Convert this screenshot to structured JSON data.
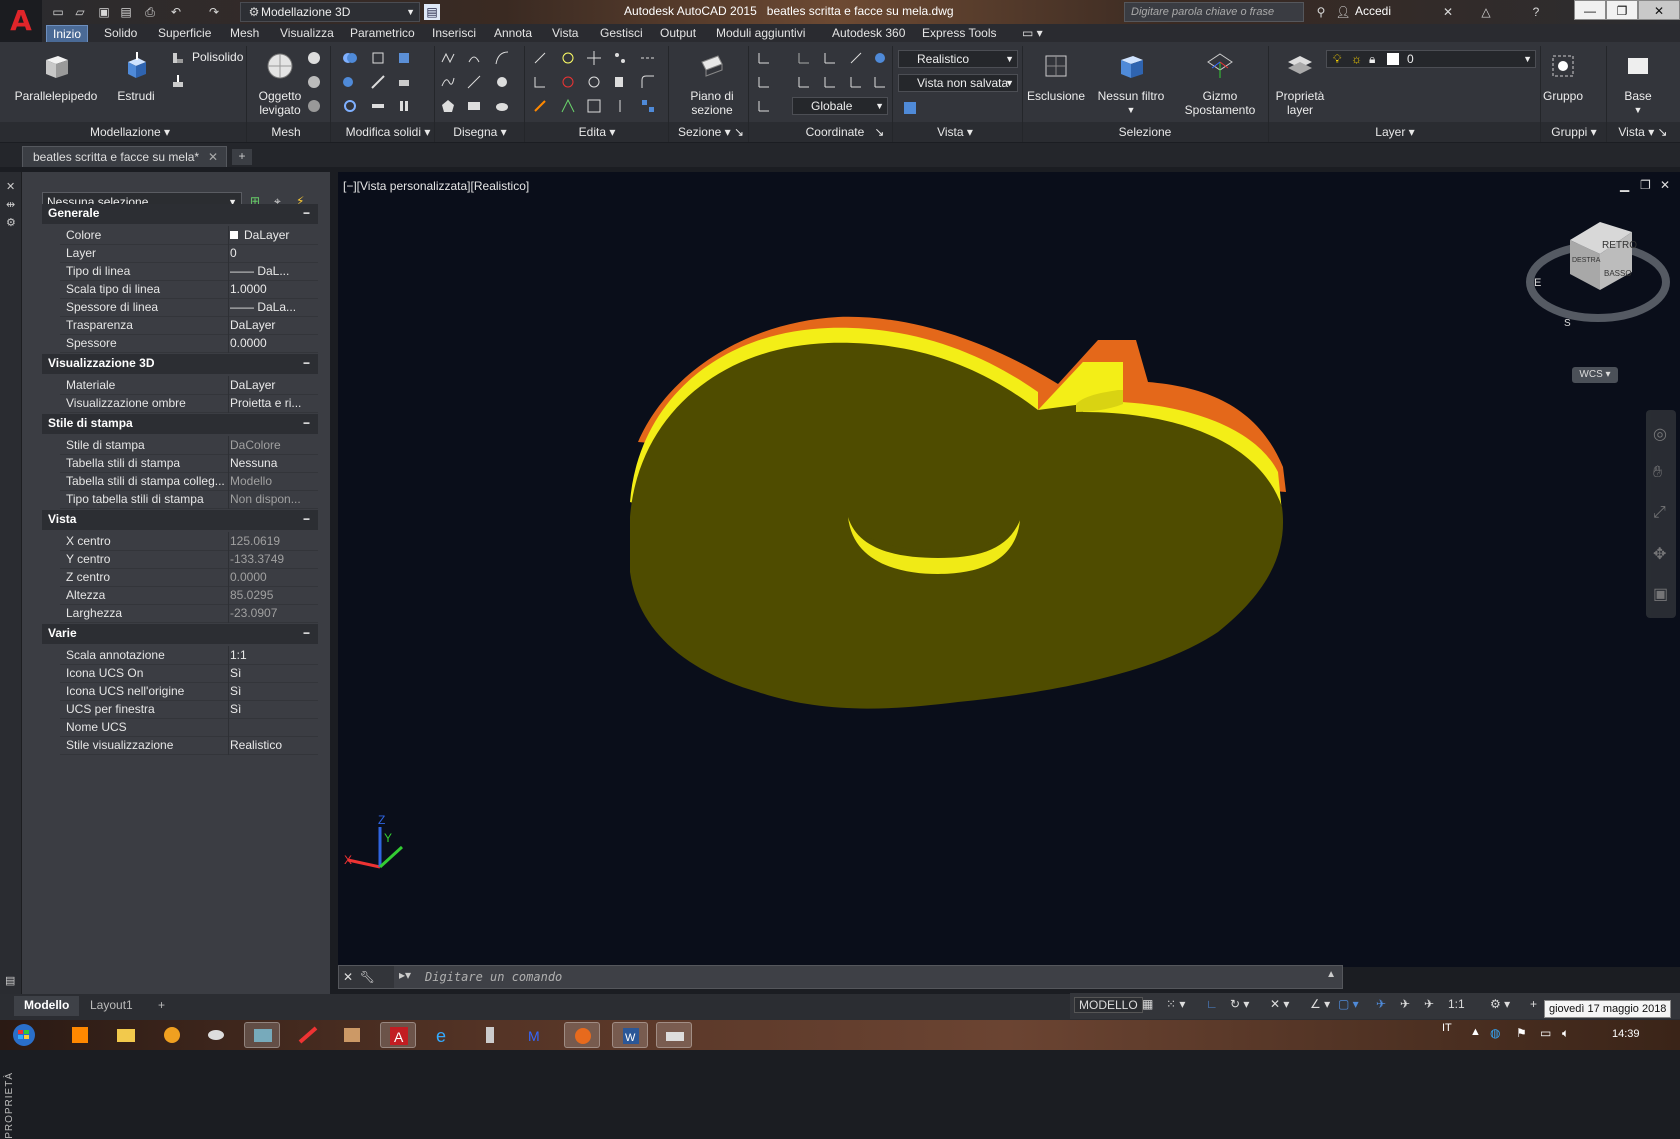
{
  "titlebar": {
    "workspace": "Modellazione 3D",
    "app_name": "Autodesk AutoCAD 2015",
    "file_name": "beatles scritta e facce su mela.dwg",
    "search_placeholder": "Digitare parola chiave o frase",
    "signin": "Accedi"
  },
  "ribbon_tabs": [
    "Inizio",
    "Solido",
    "Superficie",
    "Mesh",
    "Visualizza",
    "Parametrico",
    "Inserisci",
    "Annota",
    "Vista",
    "Gestisci",
    "Output",
    "Moduli aggiuntivi",
    "Autodesk 360",
    "Express Tools"
  ],
  "ribbon": {
    "parallelepipedo": "Parallelepipedo",
    "estrudi": "Estrudi",
    "polisolido": "Polisolido",
    "oggetto_levigato_1": "Oggetto",
    "oggetto_levigato_2": "levigato",
    "piano_sezione_1": "Piano di",
    "piano_sezione_2": "sezione",
    "visual_style": "Realistico",
    "named_view": "Vista non salvata",
    "ucs": "Globale",
    "esclusione": "Esclusione",
    "nessun_filtro": "Nessun filtro",
    "gizmo_1": "Gizmo",
    "gizmo_2": "Spostamento",
    "proprieta_1": "Proprietà",
    "proprieta_2": "layer",
    "layer_current": "0",
    "gruppo": "Gruppo",
    "base": "Base",
    "panels": {
      "modellazione": "Modellazione",
      "mesh": "Mesh",
      "modifica_solidi": "Modifica solidi",
      "disegna": "Disegna",
      "edita": "Edita",
      "sezione": "Sezione",
      "coordinate": "Coordinate",
      "vista": "Vista",
      "selezione": "Selezione",
      "layer": "Layer",
      "gruppi": "Gruppi",
      "vista2": "Vista"
    }
  },
  "doc_tab": "beatles scritta e facce su mela*",
  "properties": {
    "selection": "Nessuna selezione",
    "palette_title": "PROPRIETÀ",
    "sections": [
      {
        "title": "Generale",
        "rows": [
          {
            "k": "Colore",
            "v": "DaLayer"
          },
          {
            "k": "Layer",
            "v": "0"
          },
          {
            "k": "Tipo di linea",
            "v": "—— DaL..."
          },
          {
            "k": "Scala tipo di linea",
            "v": "1.0000"
          },
          {
            "k": "Spessore di linea",
            "v": "—— DaLa..."
          },
          {
            "k": "Trasparenza",
            "v": "DaLayer"
          },
          {
            "k": "Spessore",
            "v": "0.0000"
          }
        ]
      },
      {
        "title": "Visualizzazione 3D",
        "rows": [
          {
            "k": "Materiale",
            "v": "DaLayer"
          },
          {
            "k": "Visualizzazione ombre",
            "v": "Proietta e ri..."
          }
        ]
      },
      {
        "title": "Stile di stampa",
        "rows": [
          {
            "k": "Stile di stampa",
            "v": "DaColore"
          },
          {
            "k": "Tabella stili di stampa",
            "v": "Nessuna"
          },
          {
            "k": "Tabella stili di stampa colleg...",
            "v": "Modello"
          },
          {
            "k": "Tipo tabella stili di stampa",
            "v": "Non dispon..."
          }
        ]
      },
      {
        "title": "Vista",
        "rows": [
          {
            "k": "X centro",
            "v": "125.0619"
          },
          {
            "k": "Y centro",
            "v": "-133.3749"
          },
          {
            "k": "Z centro",
            "v": "0.0000"
          },
          {
            "k": "Altezza",
            "v": "85.0295"
          },
          {
            "k": "Larghezza",
            "v": "-23.0907"
          }
        ]
      },
      {
        "title": "Varie",
        "rows": [
          {
            "k": "Scala annotazione",
            "v": "1:1"
          },
          {
            "k": "Icona UCS On",
            "v": "Sì"
          },
          {
            "k": "Icona UCS nell'origine",
            "v": "Sì"
          },
          {
            "k": "UCS per finestra",
            "v": "Sì"
          },
          {
            "k": "Nome UCS",
            "v": ""
          },
          {
            "k": "Stile visualizzazione",
            "v": "Realistico"
          }
        ]
      }
    ]
  },
  "viewport": {
    "label": "[−][Vista personalizzata][Realistico]",
    "viewcube_top": "RETRO",
    "viewcube_front": "BASSO",
    "viewcube_left": "DESTRA",
    "compass_e": "E",
    "compass_s": "S",
    "wcs": "WCS"
  },
  "command_line": {
    "placeholder": "Digitare un comando"
  },
  "layout_tabs": [
    "Modello",
    "Layout1"
  ],
  "status": {
    "model": "MODELLO",
    "scale": "1:1",
    "date_tooltip": "giovedì 17 maggio 2018"
  },
  "taskbar": {
    "lang": "IT",
    "time": "14:39"
  },
  "colors": {
    "apple_top": "#4f4c00",
    "apple_edge_yellow": "#f2ec14",
    "apple_edge_orange": "#e4681a",
    "viewport_bg": "#0a0e1a",
    "accent": "#4a6a96"
  }
}
